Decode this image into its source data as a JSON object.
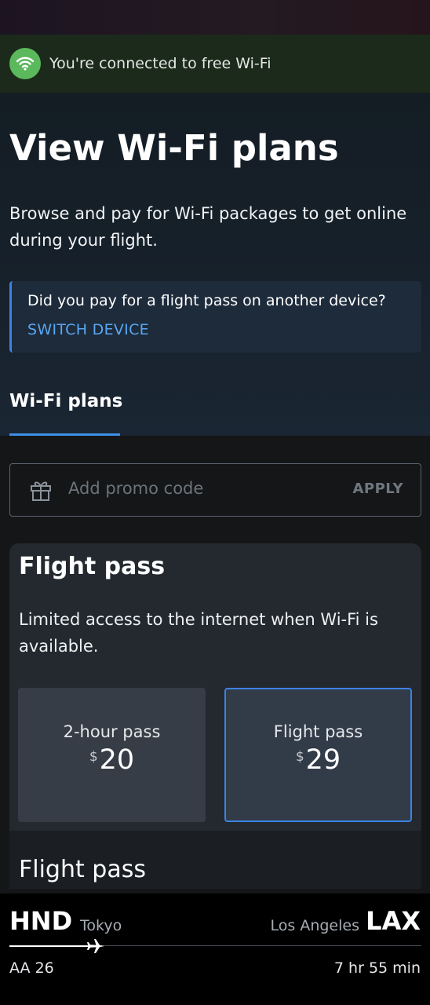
{
  "colors": {
    "accent": "#3d82e4",
    "link": "#59a6f2",
    "wifi_green": "#5cb85c",
    "banner_bg": "#1b2a1b"
  },
  "banner": {
    "icon": "wifi-icon",
    "text": "You're connected to free Wi-Fi"
  },
  "hero": {
    "title": "View Wi-Fi plans",
    "subtitle": "Browse and pay for Wi-Fi packages to get online during your flight."
  },
  "notice": {
    "text": "Did you pay for a flight pass on another device?",
    "link_label": "SWITCH DEVICE"
  },
  "tabs": [
    {
      "label": "Wi-Fi plans",
      "active": true
    }
  ],
  "promo": {
    "icon": "gift-icon",
    "placeholder": "Add promo code",
    "value": "",
    "apply_label": "APPLY"
  },
  "plan_card": {
    "title": "Flight pass",
    "description": "Limited access to the internet when Wi-Fi is available.",
    "options": [
      {
        "label": "2-hour pass",
        "currency": "$",
        "price": "20",
        "selected": false
      },
      {
        "label": "Flight pass",
        "currency": "$",
        "price": "29",
        "selected": true
      }
    ],
    "section_title": "Flight pass"
  },
  "flight": {
    "origin_code": "HND",
    "origin_city": "Tokyo",
    "dest_city": "Los Angeles",
    "dest_code": "LAX",
    "flight_number": "AA 26",
    "duration": "7 hr 55 min",
    "progress": 0.21,
    "icon": "airplane-icon"
  }
}
